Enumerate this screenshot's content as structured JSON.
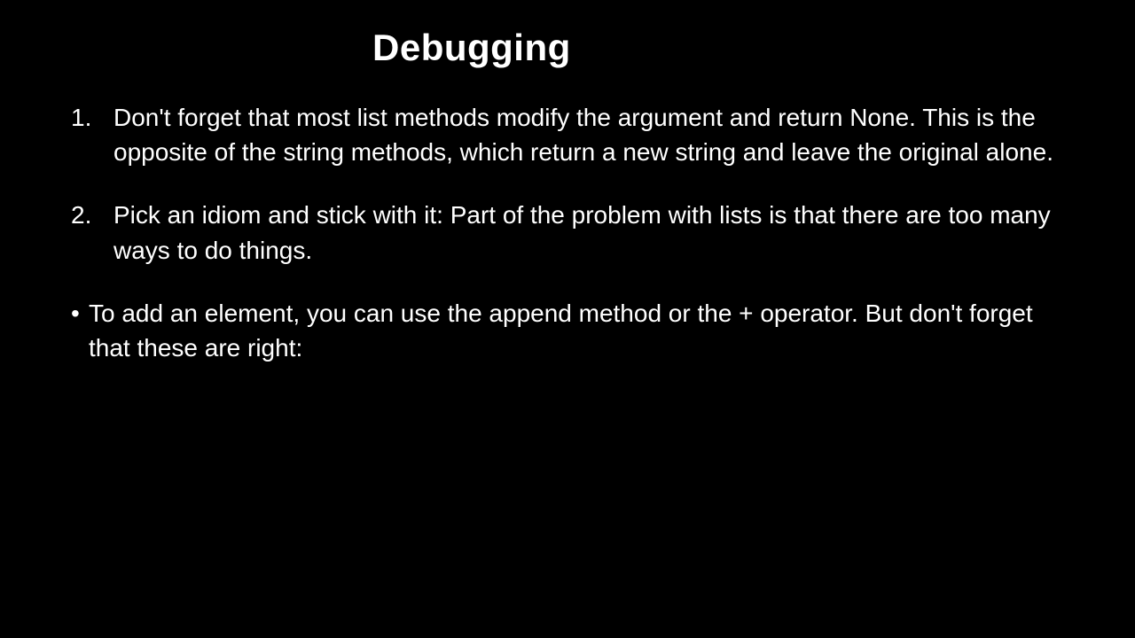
{
  "slide": {
    "title": "Debugging",
    "items": [
      {
        "number": "1.",
        "text": "Don't forget that most list methods modify the argument and return None. This is the opposite of the string methods, which return a new string and leave the original alone."
      },
      {
        "number": "2.",
        "text": "Pick an idiom and stick with it: Part of the problem with lists is that there are too many ways to do things."
      }
    ],
    "bullet": {
      "marker": "•",
      "text": "To add an element, you can use the append method or the + operator. But don't forget that these are right:"
    }
  }
}
